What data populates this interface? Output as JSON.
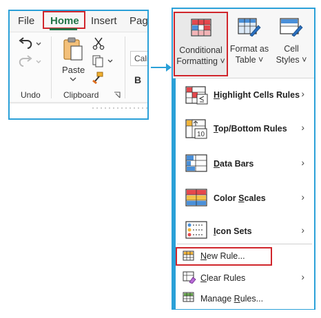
{
  "ribbon": {
    "tabs": [
      {
        "label": "File"
      },
      {
        "label": "Home"
      },
      {
        "label": "Insert"
      },
      {
        "label": "Page"
      }
    ],
    "groups": {
      "undo": {
        "label": "Undo"
      },
      "clipboard": {
        "label": "Clipboard",
        "paste_label": "Paste"
      }
    },
    "font_box": "Calib",
    "bold": "B"
  },
  "styles": {
    "conditional_formatting": {
      "line1": "Conditional",
      "line2": "Formatting ˅"
    },
    "format_as_table": {
      "line1": "Format as",
      "line2": "Table ˅"
    },
    "cell_styles": {
      "line1": "Cell",
      "line2": "Styles ˅"
    }
  },
  "menu": {
    "items": [
      {
        "label": "Highlight Cells Rules",
        "u": "H",
        "rest": "ighlight Cells Rules",
        "chevron": "›",
        "icon": "highlight-cells-icon"
      },
      {
        "label": "Top/Bottom Rules",
        "u": "T",
        "rest": "op/Bottom Rules",
        "chevron": "›",
        "icon": "top-bottom-icon",
        "num": "10"
      },
      {
        "label": "Data Bars",
        "u": "D",
        "rest": "ata Bars",
        "chevron": "›",
        "icon": "data-bars-icon"
      },
      {
        "label": "Color Scales",
        "pre": "Color ",
        "u": "S",
        "rest": "cales",
        "chevron": "›",
        "icon": "color-scales-icon"
      },
      {
        "label": "Icon Sets",
        "u": "I",
        "rest": "con Sets",
        "chevron": "›",
        "icon": "icon-sets-icon"
      }
    ],
    "new_rule": {
      "u": "N",
      "rest": "ew Rule..."
    },
    "clear_rules": {
      "u": "C",
      "rest": "lear Rules",
      "chevron": "›"
    },
    "manage_rules": {
      "pre": "Manage ",
      "u": "R",
      "rest": "ules..."
    }
  },
  "colors": {
    "accent_blue": "#2aa0d8",
    "highlight_red": "#d0252b",
    "excel_green": "#217346"
  }
}
